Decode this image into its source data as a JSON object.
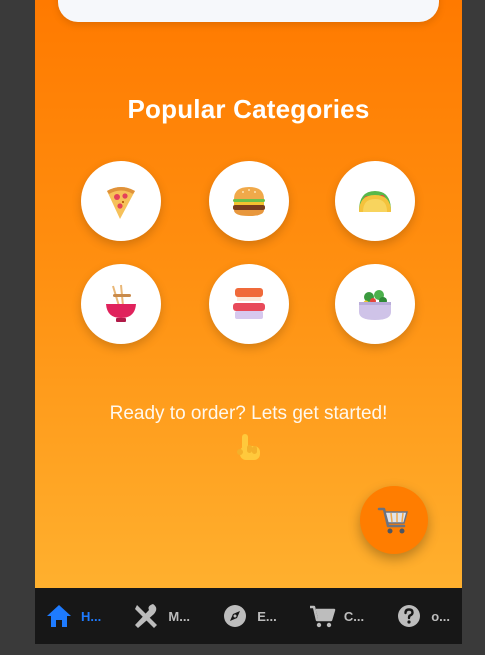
{
  "categories_section": {
    "title": "Popular Categories",
    "items": [
      {
        "icon": "pizza-icon"
      },
      {
        "icon": "burger-icon"
      },
      {
        "icon": "taco-icon"
      },
      {
        "icon": "noodles-icon"
      },
      {
        "icon": "sushi-icon"
      },
      {
        "icon": "salad-icon"
      }
    ]
  },
  "cta": {
    "text": "Ready to order? Lets get started!",
    "icon": "pointing-hand-icon"
  },
  "fab": {
    "icon": "shopping-cart-icon"
  },
  "bottom_nav": {
    "items": [
      {
        "label": "H...",
        "icon": "home-icon",
        "active": true
      },
      {
        "label": "M...",
        "icon": "utensils-icon",
        "active": false
      },
      {
        "label": "E...",
        "icon": "compass-icon",
        "active": false
      },
      {
        "label": "C...",
        "icon": "cart-icon",
        "active": false
      },
      {
        "label": "o...",
        "icon": "help-icon",
        "active": false
      }
    ]
  },
  "colors": {
    "gradient_top": "#ff7a00",
    "gradient_bottom": "#ffb02e",
    "nav_background": "#171717",
    "nav_active": "#1e7bff",
    "nav_inactive": "#bdbdbd"
  }
}
